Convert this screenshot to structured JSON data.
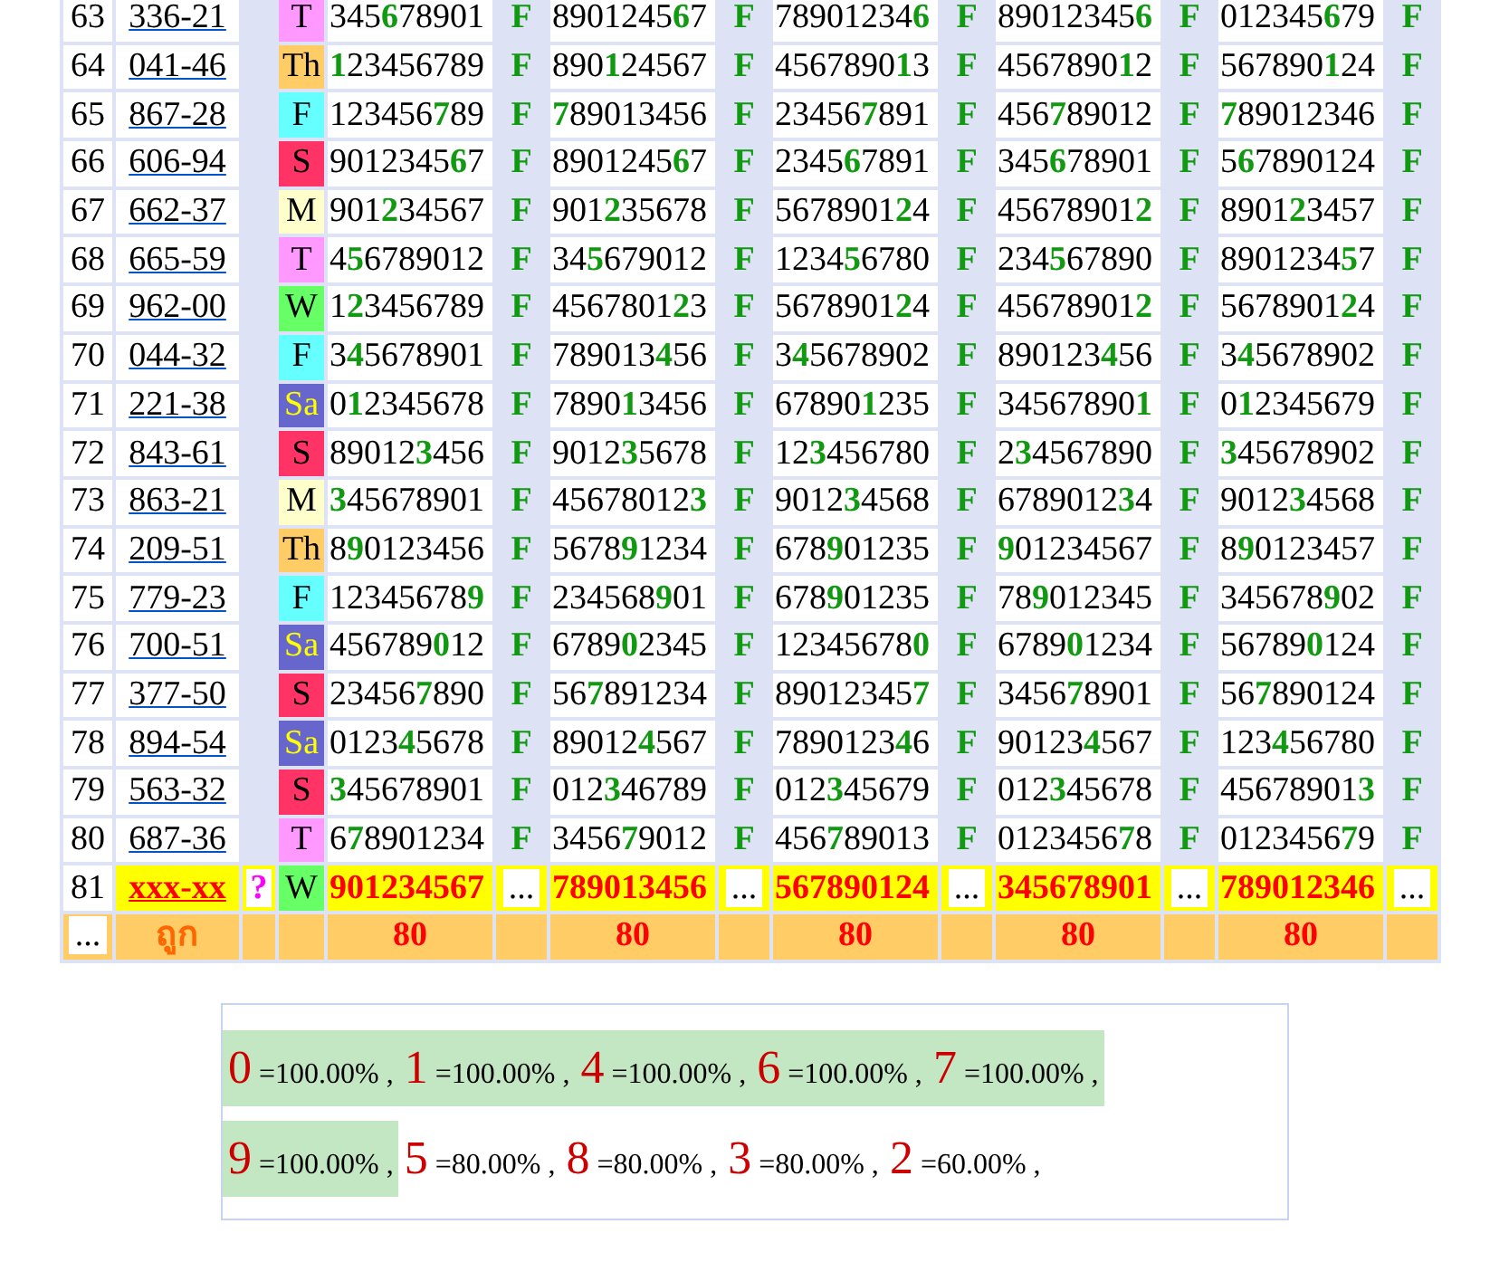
{
  "rows": [
    {
      "no": "63",
      "code": "336-21",
      "day": {
        "label": "T",
        "color": "#ff99ff",
        "light_text": false
      },
      "results": [
        {
          "number": "345**6**78901",
          "mark": "F"
        },
        {
          "number": "8901245**6**7",
          "mark": "F"
        },
        {
          "number": "78901234**6**",
          "mark": "F"
        },
        {
          "number": "89012345**6**",
          "mark": "F"
        },
        {
          "number": "012345**6**79",
          "mark": "F"
        }
      ]
    },
    {
      "no": "64",
      "code": "041-46",
      "day": {
        "label": "Th",
        "color": "#ffcc66",
        "light_text": false
      },
      "results": [
        {
          "number": "**1**23456789",
          "mark": "F"
        },
        {
          "number": "890**1**24567",
          "mark": "F"
        },
        {
          "number": "4567890**1**3",
          "mark": "F"
        },
        {
          "number": "4567890**1**2",
          "mark": "F"
        },
        {
          "number": "567890**1**24",
          "mark": "F"
        }
      ]
    },
    {
      "no": "65",
      "code": "867-28",
      "day": {
        "label": "F",
        "color": "#66ffff",
        "light_text": false
      },
      "results": [
        {
          "number": "123456**7**89",
          "mark": "F"
        },
        {
          "number": "**7**89013456",
          "mark": "F"
        },
        {
          "number": "23456**7**891",
          "mark": "F"
        },
        {
          "number": "456**7**89012",
          "mark": "F"
        },
        {
          "number": "**7**89012346",
          "mark": "F"
        }
      ]
    },
    {
      "no": "66",
      "code": "606-94",
      "day": {
        "label": "S",
        "color": "#ff3366",
        "light_text": false
      },
      "results": [
        {
          "number": "9012345**6**7",
          "mark": "F"
        },
        {
          "number": "8901245**6**7",
          "mark": "F"
        },
        {
          "number": "2345**6**7891",
          "mark": "F"
        },
        {
          "number": "345**6**78901",
          "mark": "F"
        },
        {
          "number": "5**6**7890124",
          "mark": "F"
        }
      ]
    },
    {
      "no": "67",
      "code": "662-37",
      "day": {
        "label": "M",
        "color": "#ffffcc",
        "light_text": false
      },
      "results": [
        {
          "number": "901**2**34567",
          "mark": "F"
        },
        {
          "number": "901**2**35678",
          "mark": "F"
        },
        {
          "number": "5678901**2**4",
          "mark": "F"
        },
        {
          "number": "45678901**2**",
          "mark": "F"
        },
        {
          "number": "8901**2**3457",
          "mark": "F"
        }
      ]
    },
    {
      "no": "68",
      "code": "665-59",
      "day": {
        "label": "T",
        "color": "#ff99ff",
        "light_text": false
      },
      "results": [
        {
          "number": "4**5**6789012",
          "mark": "F"
        },
        {
          "number": "34**5**679012",
          "mark": "F"
        },
        {
          "number": "1234**5**6780",
          "mark": "F"
        },
        {
          "number": "234**5**67890",
          "mark": "F"
        },
        {
          "number": "8901234**5**7",
          "mark": "F"
        }
      ]
    },
    {
      "no": "69",
      "code": "962-00",
      "day": {
        "label": "W",
        "color": "#66ff66",
        "light_text": false
      },
      "results": [
        {
          "number": "1**2**3456789",
          "mark": "F"
        },
        {
          "number": "4567801**2**3",
          "mark": "F"
        },
        {
          "number": "5678901**2**4",
          "mark": "F"
        },
        {
          "number": "45678901**2**",
          "mark": "F"
        },
        {
          "number": "5678901**2**4",
          "mark": "F"
        }
      ]
    },
    {
      "no": "70",
      "code": "044-32",
      "day": {
        "label": "F",
        "color": "#66ffff",
        "light_text": false
      },
      "results": [
        {
          "number": "3**4**5678901",
          "mark": "F"
        },
        {
          "number": "789013**4**56",
          "mark": "F"
        },
        {
          "number": "3**4**5678902",
          "mark": "F"
        },
        {
          "number": "890123**4**56",
          "mark": "F"
        },
        {
          "number": "3**4**5678902",
          "mark": "F"
        }
      ]
    },
    {
      "no": "71",
      "code": "221-38",
      "day": {
        "label": "Sa",
        "color": "#6666cc",
        "light_text": true
      },
      "results": [
        {
          "number": "0**1**2345678",
          "mark": "F"
        },
        {
          "number": "7890**1**3456",
          "mark": "F"
        },
        {
          "number": "67890**1**235",
          "mark": "F"
        },
        {
          "number": "34567890**1**",
          "mark": "F"
        },
        {
          "number": "0**1**2345679",
          "mark": "F"
        }
      ]
    },
    {
      "no": "72",
      "code": "843-61",
      "day": {
        "label": "S",
        "color": "#ff3366",
        "light_text": false
      },
      "results": [
        {
          "number": "89012**3**456",
          "mark": "F"
        },
        {
          "number": "9012**3**5678",
          "mark": "F"
        },
        {
          "number": "12**3**456780",
          "mark": "F"
        },
        {
          "number": "2**3**4567890",
          "mark": "F"
        },
        {
          "number": "**3**45678902",
          "mark": "F"
        }
      ]
    },
    {
      "no": "73",
      "code": "863-21",
      "day": {
        "label": "M",
        "color": "#ffffcc",
        "light_text": false
      },
      "results": [
        {
          "number": "**3**45678901",
          "mark": "F"
        },
        {
          "number": "45678012**3**",
          "mark": "F"
        },
        {
          "number": "9012**3**4568",
          "mark": "F"
        },
        {
          "number": "6789012**3**4",
          "mark": "F"
        },
        {
          "number": "9012**3**4568",
          "mark": "F"
        }
      ]
    },
    {
      "no": "74",
      "code": "209-51",
      "day": {
        "label": "Th",
        "color": "#ffcc66",
        "light_text": false
      },
      "results": [
        {
          "number": "8**9**0123456",
          "mark": "F"
        },
        {
          "number": "5678**9**1234",
          "mark": "F"
        },
        {
          "number": "678**9**01235",
          "mark": "F"
        },
        {
          "number": "**9**01234567",
          "mark": "F"
        },
        {
          "number": "8**9**0123457",
          "mark": "F"
        }
      ]
    },
    {
      "no": "75",
      "code": "779-23",
      "day": {
        "label": "F",
        "color": "#66ffff",
        "light_text": false
      },
      "results": [
        {
          "number": "12345678**9**",
          "mark": "F"
        },
        {
          "number": "234568**9**01",
          "mark": "F"
        },
        {
          "number": "678**9**01235",
          "mark": "F"
        },
        {
          "number": "78**9**012345",
          "mark": "F"
        },
        {
          "number": "345678**9**02",
          "mark": "F"
        }
      ]
    },
    {
      "no": "76",
      "code": "700-51",
      "day": {
        "label": "Sa",
        "color": "#6666cc",
        "light_text": true
      },
      "results": [
        {
          "number": "456789**0**12",
          "mark": "F"
        },
        {
          "number": "6789**0**2345",
          "mark": "F"
        },
        {
          "number": "12345678**0**",
          "mark": "F"
        },
        {
          "number": "6789**0**1234",
          "mark": "F"
        },
        {
          "number": "56789**0**124",
          "mark": "F"
        }
      ]
    },
    {
      "no": "77",
      "code": "377-50",
      "day": {
        "label": "S",
        "color": "#ff3366",
        "light_text": false
      },
      "results": [
        {
          "number": "23456**7**890",
          "mark": "F"
        },
        {
          "number": "56**7**891234",
          "mark": "F"
        },
        {
          "number": "89012345**7**",
          "mark": "F"
        },
        {
          "number": "3456**7**8901",
          "mark": "F"
        },
        {
          "number": "56**7**890124",
          "mark": "F"
        }
      ]
    },
    {
      "no": "78",
      "code": "894-54",
      "day": {
        "label": "Sa",
        "color": "#6666cc",
        "light_text": true
      },
      "results": [
        {
          "number": "0123**4**5678",
          "mark": "F"
        },
        {
          "number": "89012**4**567",
          "mark": "F"
        },
        {
          "number": "7890123**4**6",
          "mark": "F"
        },
        {
          "number": "90123**4**567",
          "mark": "F"
        },
        {
          "number": "123**4**56780",
          "mark": "F"
        }
      ]
    },
    {
      "no": "79",
      "code": "563-32",
      "day": {
        "label": "S",
        "color": "#ff3366",
        "light_text": false
      },
      "results": [
        {
          "number": "**3**45678901",
          "mark": "F"
        },
        {
          "number": "012**3**46789",
          "mark": "F"
        },
        {
          "number": "012**3**45679",
          "mark": "F"
        },
        {
          "number": "012**3**45678",
          "mark": "F"
        },
        {
          "number": "45678901**3**",
          "mark": "F"
        }
      ]
    },
    {
      "no": "80",
      "code": "687-36",
      "day": {
        "label": "T",
        "color": "#ff99ff",
        "light_text": false
      },
      "results": [
        {
          "number": "6**7**8901234",
          "mark": "F"
        },
        {
          "number": "3456**7**9012",
          "mark": "F"
        },
        {
          "number": "456**7**89013",
          "mark": "F"
        },
        {
          "number": "0123456**7**8",
          "mark": "F"
        },
        {
          "number": "0123456**7**9",
          "mark": "F"
        }
      ]
    }
  ],
  "pending_row": {
    "no": "81",
    "code": "xxx-xx",
    "flag": "?",
    "day": {
      "label": "W",
      "color": "#66ff66",
      "light_text": false
    },
    "results": [
      {
        "number": "901234567",
        "mark": "..."
      },
      {
        "number": "789013456",
        "mark": "..."
      },
      {
        "number": "567890124",
        "mark": "..."
      },
      {
        "number": "345678901",
        "mark": "..."
      },
      {
        "number": "789012346",
        "mark": "..."
      }
    ]
  },
  "totals_row": {
    "more": "...",
    "label": "ถูก",
    "counts": [
      "80",
      "80",
      "80",
      "80",
      "80"
    ]
  },
  "stats": {
    "lines": [
      [
        {
          "digit": "0",
          "value": "=100.00%",
          "sep": ",",
          "highlight": true
        },
        {
          "digit": "1",
          "value": "=100.00%",
          "sep": ",",
          "highlight": true
        },
        {
          "digit": "4",
          "value": "=100.00%",
          "sep": ",",
          "highlight": true
        },
        {
          "digit": "6",
          "value": "=100.00%",
          "sep": ",",
          "highlight": true
        },
        {
          "digit": "7",
          "value": "=100.00%",
          "sep": ",",
          "highlight": true
        }
      ],
      [
        {
          "digit": "9",
          "value": "=100.00%",
          "sep": ",",
          "highlight": true
        },
        {
          "digit": "5",
          "value": "=80.00%",
          "sep": ",",
          "highlight": false
        },
        {
          "digit": "8",
          "value": "=80.00%",
          "sep": ",",
          "highlight": false
        },
        {
          "digit": "3",
          "value": "=80.00%",
          "sep": ",",
          "highlight": false
        },
        {
          "digit": "2",
          "value": "=60.00%",
          "sep": ",",
          "highlight": false
        }
      ]
    ]
  }
}
